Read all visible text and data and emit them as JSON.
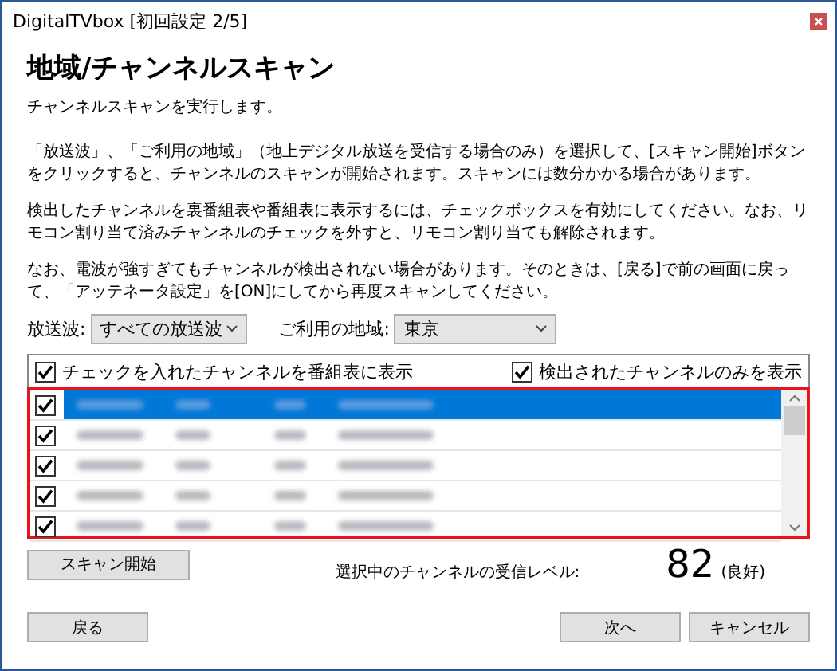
{
  "window": {
    "title": "DigitalTVbox [初回設定 2/5]"
  },
  "heading": "地域/チャンネルスキャン",
  "intro": "チャンネルスキャンを実行します。",
  "paragraphs": [
    "「放送波」、「ご利用の地域」（地上デジタル放送を受信する場合のみ）を選択して、[スキャン開始]ボタンをクリックすると、チャンネルのスキャンが開始されます。スキャンには数分かかる場合があります。",
    "検出したチャンネルを裏番組表や番組表に表示するには、チェックボックスを有効にしてください。なお、リモコン割り当て済みチャンネルのチェックを外すと、リモコン割り当ても解除されます。",
    "なお、電波が強すぎてもチャンネルが検出されない場合があります。そのときは、[戻る]で前の画面に戻って、「アッテネータ設定」を[ON]にしてから再度スキャンしてください。"
  ],
  "broadcast": {
    "label": "放送波:",
    "value": "すべての放送波"
  },
  "region": {
    "label": "ご利用の地域:",
    "value": "東京"
  },
  "options": [
    {
      "label": "チェックを入れたチャンネルを番組表に表示",
      "checked": true
    },
    {
      "label": "検出されたチャンネルのみを表示",
      "checked": true
    }
  ],
  "channels": [
    {
      "checked": true,
      "selected": true
    },
    {
      "checked": true,
      "selected": false
    },
    {
      "checked": true,
      "selected": false
    },
    {
      "checked": true,
      "selected": false
    },
    {
      "checked": true,
      "selected": false
    }
  ],
  "scan_button": "スキャン開始",
  "level_label": "選択中のチャンネルの受信レベル:",
  "level_value": "82",
  "level_note": "(良好)",
  "buttons": [
    {
      "label": "戻る"
    },
    {
      "label": "次へ"
    },
    {
      "label": "キャンセル"
    }
  ]
}
